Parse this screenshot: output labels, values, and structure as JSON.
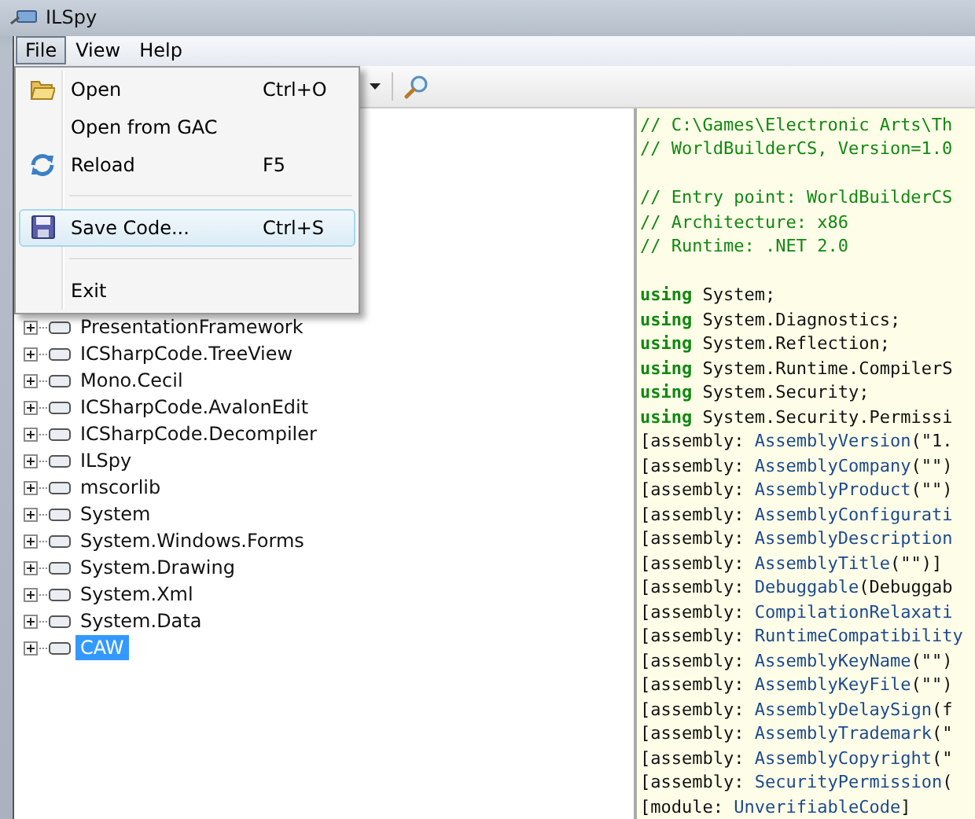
{
  "window": {
    "title": "ILSpy"
  },
  "menu_bar": [
    {
      "label": "File",
      "selected": true
    },
    {
      "label": "View",
      "selected": false
    },
    {
      "label": "Help",
      "selected": false
    }
  ],
  "file_menu": [
    {
      "kind": "item",
      "label": "Open",
      "shortcut": "Ctrl+O",
      "highlighted": false
    },
    {
      "kind": "item",
      "label": "Open from GAC",
      "highlighted": false
    },
    {
      "kind": "item",
      "label": "Reload",
      "shortcut": "F5",
      "highlighted": false
    },
    {
      "kind": "separator"
    },
    {
      "kind": "item",
      "label": "Save Code...",
      "shortcut": "Ctrl+S",
      "highlighted": true
    },
    {
      "kind": "separator"
    },
    {
      "kind": "item",
      "label": "Exit",
      "highlighted": false
    }
  ],
  "tree": [
    {
      "label": "PresentationFramework",
      "selected": false
    },
    {
      "label": "ICSharpCode.TreeView",
      "selected": false
    },
    {
      "label": "Mono.Cecil",
      "selected": false
    },
    {
      "label": "ICSharpCode.AvalonEdit",
      "selected": false
    },
    {
      "label": "ICSharpCode.Decompiler",
      "selected": false
    },
    {
      "label": "ILSpy",
      "selected": false
    },
    {
      "label": "mscorlib",
      "selected": false
    },
    {
      "label": "System",
      "selected": false
    },
    {
      "label": "System.Windows.Forms",
      "selected": false
    },
    {
      "label": "System.Drawing",
      "selected": false
    },
    {
      "label": "System.Xml",
      "selected": false
    },
    {
      "label": "System.Data",
      "selected": false
    },
    {
      "label": "CAW",
      "selected": true
    }
  ],
  "code": [
    {
      "kind": "comment",
      "text": "// C:\\Games\\Electronic Arts\\Th"
    },
    {
      "kind": "comment",
      "text": "// WorldBuilderCS, Version=1.0"
    },
    {
      "kind": "blank"
    },
    {
      "kind": "comment",
      "text": "// Entry point: WorldBuilderCS"
    },
    {
      "kind": "comment",
      "text": "// Architecture: x86"
    },
    {
      "kind": "comment",
      "text": "// Runtime: .NET 2.0"
    },
    {
      "kind": "blank"
    },
    {
      "kind": "using",
      "keyword": "using",
      "text": "System;"
    },
    {
      "kind": "using",
      "keyword": "using",
      "text": "System.Diagnostics;"
    },
    {
      "kind": "using",
      "keyword": "using",
      "text": "System.Reflection;"
    },
    {
      "kind": "using",
      "keyword": "using",
      "text": "System.Runtime.CompilerS"
    },
    {
      "kind": "using",
      "keyword": "using",
      "text": "System.Security;"
    },
    {
      "kind": "using",
      "keyword": "using",
      "text": "System.Security.Permissi"
    },
    {
      "kind": "attribute",
      "target": "[assembly:",
      "name": "AssemblyVersion",
      "rest": "(\"1."
    },
    {
      "kind": "attribute",
      "target": "[assembly:",
      "name": "AssemblyCompany",
      "rest": "(\"\")"
    },
    {
      "kind": "attribute",
      "target": "[assembly:",
      "name": "AssemblyProduct",
      "rest": "(\"\")"
    },
    {
      "kind": "attribute",
      "target": "[assembly:",
      "name": "AssemblyConfigurati"
    },
    {
      "kind": "attribute",
      "target": "[assembly:",
      "name": "AssemblyDescription"
    },
    {
      "kind": "attribute",
      "target": "[assembly:",
      "name": "AssemblyTitle",
      "rest": "(\"\")]"
    },
    {
      "kind": "attribute",
      "target": "[assembly:",
      "name": "Debuggable",
      "rest": "(Debuggab"
    },
    {
      "kind": "attribute",
      "target": "[assembly:",
      "name": "CompilationRelaxati"
    },
    {
      "kind": "attribute",
      "target": "[assembly:",
      "name": "RuntimeCompatibility"
    },
    {
      "kind": "attribute",
      "target": "[assembly:",
      "name": "AssemblyKeyName",
      "rest": "(\"\")"
    },
    {
      "kind": "attribute",
      "target": "[assembly:",
      "name": "AssemblyKeyFile",
      "rest": "(\"\")"
    },
    {
      "kind": "attribute",
      "target": "[assembly:",
      "name": "AssemblyDelaySign",
      "rest": "(f"
    },
    {
      "kind": "attribute",
      "target": "[assembly:",
      "name": "AssemblyTrademark",
      "rest": "(\""
    },
    {
      "kind": "attribute",
      "target": "[assembly:",
      "name": "AssemblyCopyright",
      "rest": "(\""
    },
    {
      "kind": "attribute",
      "target": "[assembly:",
      "name": "SecurityPermission",
      "rest": "("
    },
    {
      "kind": "attribute",
      "target": "[module:",
      "name": "UnverifiableCode",
      "rest": "]"
    }
  ]
}
